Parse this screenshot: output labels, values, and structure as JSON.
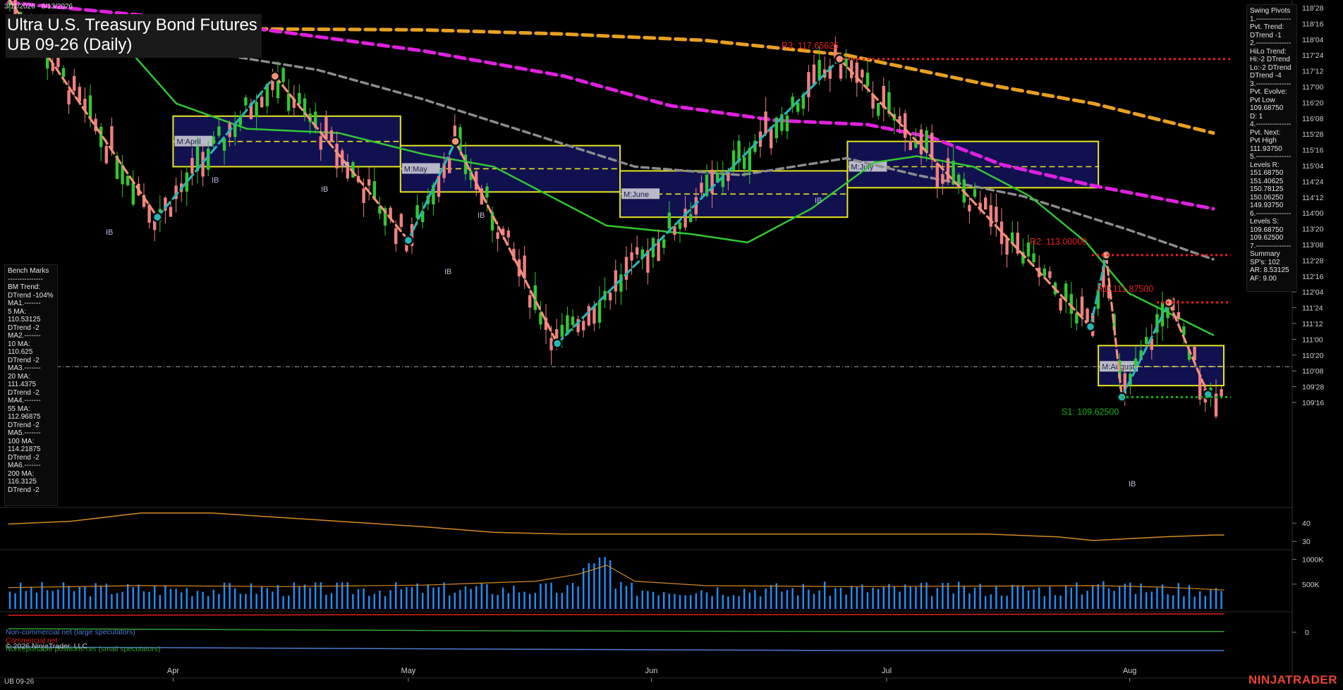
{
  "header": {
    "date_range": "3/11/2026 - 8/13/2026",
    "title": "Ultra U.S. Treasury Bond Futures",
    "subtitle": "UB 09-26 (Daily)"
  },
  "swing_pivots": {
    "lines": [
      "Swing Pivots",
      "1.---------------",
      "Pvt. Trend:",
      "DTrend -1",
      "2.---------------",
      "HiLo Trend:",
      "Hi:-2 DTrend",
      "Lo:-2 DTrend",
      "DTrend -4",
      "3.---------------",
      "Pvt. Evolve:",
      "Pvt Low",
      "109.68750",
      "D: 1",
      "4.---------------",
      "Pvt. Next:",
      "Pvt High",
      "111.93750",
      "5.---------------",
      "Levels R:",
      "151.68750",
      "151.40625",
      "150.78125",
      "150.06250",
      "149.93750",
      "6.---------------",
      "Levels S:",
      "109.68750",
      "109.62500",
      "7.---------------",
      "Summary",
      "SP's: 102",
      "AR: 8.53125",
      "AF: 9.00"
    ]
  },
  "bench_marks": {
    "lines": [
      "Bench Marks",
      "---------------",
      "BM Trend:",
      "DTrend -104%",
      "MA1.-------",
      "5 MA:",
      "110.53125",
      "DTrend -2",
      "MA2.-------",
      "10 MA:",
      "110.625",
      "DTrend -2",
      "MA3.-------",
      "20 MA:",
      "111.4375",
      "DTrend -2",
      "MA4.-------",
      "55 MA:",
      "112.96875",
      "DTrend -2",
      "MA5.-------",
      "100 MA:",
      "114.21875",
      "DTrend -2",
      "MA6.-------",
      "200 MA:",
      "116.3125",
      "DTrend -2"
    ]
  },
  "levels": {
    "r3": "R3: 117.65625",
    "r2": "R2: 113.00000",
    "r1": "R1: 111.87500",
    "s1": "S1: 109.62500"
  },
  "price_axis_labels": [
    "118'28",
    "118'16",
    "118'04",
    "117'24",
    "117'12",
    "117'00",
    "116'20",
    "116'08",
    "115'28",
    "115'16",
    "115'04",
    "114'24",
    "114'12",
    "114'00",
    "113'20",
    "113'08",
    "112'28",
    "112'16",
    "112'04",
    "111'24",
    "111'12",
    "111'00",
    "110'20",
    "110'08",
    "109'28",
    "109'16"
  ],
  "osc_axis_labels": [
    "40",
    "30"
  ],
  "vol_axis_labels": [
    "1000K",
    "500K"
  ],
  "cot_axis_labels": [
    "0"
  ],
  "x_axis_labels": [
    "Apr",
    "May",
    "Jun",
    "Jul",
    "Aug"
  ],
  "monthly_boxes": [
    "M:April",
    "M:May",
    "M:June",
    "M:July",
    "M:August"
  ],
  "ib_label": "IB",
  "cot_legend": {
    "noncommercial": "Non-commercial net (large speculators)",
    "commercial": "Commercial net",
    "copyright": "© 2026 NinjaTrader, LLC",
    "nonreportable": "Nonreportable positions net (small speculators)"
  },
  "footer": {
    "symbol": "UB 09-26",
    "brand": "NINJATRADER"
  },
  "colors": {
    "bg": "#000000",
    "up": "#32c832",
    "down": "#f08080",
    "box": "#14145e",
    "box_border": "#e6e61e",
    "ma200": "#e8a020",
    "ma100": "#e020e0",
    "ma55": "#8c8c8c",
    "ma20": "#32c832",
    "swing_down": "#f59278",
    "swing_up": "#28b4b4",
    "resistance": "#e81e1e",
    "support": "#14b414",
    "volume": "#1e90ff",
    "osc": "#d48a20",
    "cot_noncomm": "#4e7ad0",
    "cot_comm": "#e01e1e",
    "cot_small": "#32a032"
  },
  "chart_data": {
    "type": "candlestick",
    "title": "Ultra U.S. Treasury Bond Futures",
    "subtitle": "UB 09-26 (Daily)",
    "date_range": [
      "2026-03-11",
      "2026-08-13"
    ],
    "ylim": [
      109.3125,
      119.0
    ],
    "x_labels": [
      "Apr",
      "May",
      "Jun",
      "Jul",
      "Aug"
    ],
    "swing_pivots": [
      {
        "date": "Mar 11",
        "price": 119.1,
        "type": "high"
      },
      {
        "date": "Mar 30",
        "price": 113.9,
        "type": "low"
      },
      {
        "date": "Apr 14",
        "price": 117.25,
        "type": "high"
      },
      {
        "date": "May 01",
        "price": 113.35,
        "type": "low"
      },
      {
        "date": "May 07",
        "price": 115.7,
        "type": "high"
      },
      {
        "date": "May 20",
        "price": 110.9,
        "type": "low"
      },
      {
        "date": "Jun 25",
        "price": 117.65625,
        "type": "high"
      },
      {
        "date": "Jul 27",
        "price": 111.3,
        "type": "low"
      },
      {
        "date": "Jul 29",
        "price": 113.0,
        "type": "high"
      },
      {
        "date": "Jul 31",
        "price": 109.625,
        "type": "low"
      },
      {
        "date": "Aug 06",
        "price": 111.875,
        "type": "high"
      },
      {
        "date": "Aug 11",
        "price": 109.6875,
        "type": "low"
      }
    ],
    "levels": {
      "R3": 117.65625,
      "R2": 113.0,
      "R1": 111.875,
      "S1": 109.625
    },
    "moving_averages": {
      "5MA": 110.53125,
      "10MA": 110.625,
      "20MA": 111.4375,
      "55MA": 112.96875,
      "100MA": 114.21875,
      "200MA": 116.3125
    },
    "monthly_ranges": [
      {
        "label": "M:April",
        "high": 116.3,
        "low": 115.1,
        "mid": 115.7
      },
      {
        "label": "M:May",
        "high": 115.6,
        "low": 114.5,
        "mid": 115.05
      },
      {
        "label": "M:June",
        "high": 115.0,
        "low": 113.9,
        "mid": 114.45
      },
      {
        "label": "M:July",
        "high": 115.7,
        "low": 114.6,
        "mid": 115.1
      },
      {
        "label": "M:August",
        "high": 110.85,
        "low": 109.9,
        "mid": 110.35
      }
    ],
    "oscillator_ylim": [
      27,
      47
    ],
    "volume_ylim": [
      0,
      1150
    ]
  }
}
